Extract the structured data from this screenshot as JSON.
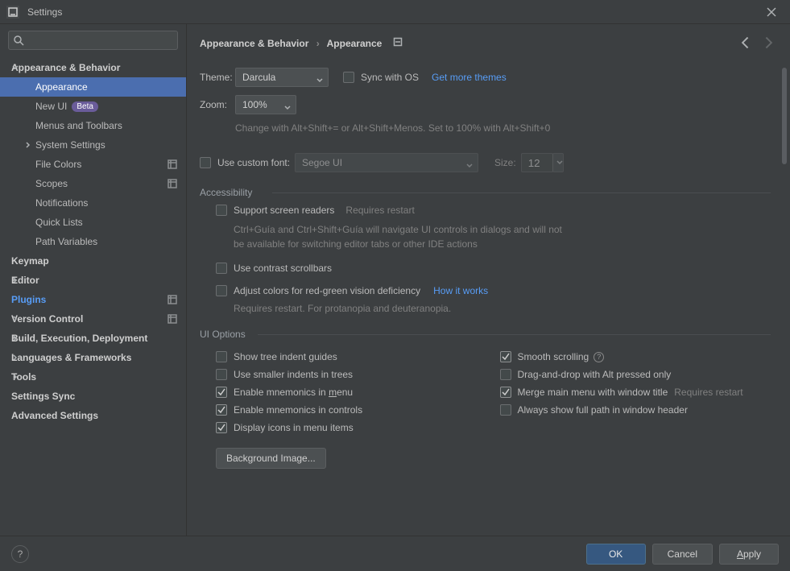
{
  "window": {
    "title": "Settings"
  },
  "search": {
    "placeholder": ""
  },
  "sidebar": [
    {
      "label": "Appearance & Behavior",
      "level": 0,
      "expandable": true,
      "expanded": true
    },
    {
      "label": "Appearance",
      "level": 1,
      "selected": true
    },
    {
      "label": "New UI",
      "level": 1,
      "badge": "Beta"
    },
    {
      "label": "Menus and Toolbars",
      "level": 1
    },
    {
      "label": "System Settings",
      "level": 1,
      "expandable": true,
      "expanded": false
    },
    {
      "label": "File Colors",
      "level": 1,
      "gear": true
    },
    {
      "label": "Scopes",
      "level": 1,
      "gear": true
    },
    {
      "label": "Notifications",
      "level": 1
    },
    {
      "label": "Quick Lists",
      "level": 1
    },
    {
      "label": "Path Variables",
      "level": 1
    },
    {
      "label": "Keymap",
      "level": 0
    },
    {
      "label": "Editor",
      "level": 0,
      "expandable": true,
      "expanded": false
    },
    {
      "label": "Plugins",
      "level": 0,
      "blue": true,
      "gear": true
    },
    {
      "label": "Version Control",
      "level": 0,
      "expandable": true,
      "expanded": false,
      "gear": true
    },
    {
      "label": "Build, Execution, Deployment",
      "level": 0,
      "expandable": true,
      "expanded": false
    },
    {
      "label": "Languages & Frameworks",
      "level": 0,
      "expandable": true,
      "expanded": false
    },
    {
      "label": "Tools",
      "level": 0,
      "expandable": true,
      "expanded": false
    },
    {
      "label": "Settings Sync",
      "level": 0
    },
    {
      "label": "Advanced Settings",
      "level": 0
    }
  ],
  "breadcrumb": {
    "root": "Appearance & Behavior",
    "leaf": "Appearance"
  },
  "theme": {
    "label": "Theme:",
    "value": "Darcula",
    "sync_label": "Sync with OS",
    "sync_checked": false,
    "more_link": "Get more themes"
  },
  "zoom": {
    "label": "Zoom:",
    "value": "100%",
    "hint": "Change with Alt+Shift+= or Alt+Shift+Menos. Set to 100% with Alt+Shift+0"
  },
  "custom_font": {
    "checked": false,
    "label": "Use custom font:",
    "font": "Segoe UI",
    "size_label": "Size:",
    "size": "12"
  },
  "accessibility": {
    "title": "Accessibility",
    "screen_readers": {
      "checked": false,
      "label": "Support screen readers",
      "suffix": "Requires restart",
      "hint": "Ctrl+Guía and Ctrl+Shift+Guía will navigate UI controls in dialogs and will not be available for switching editor tabs or other IDE actions"
    },
    "contrast": {
      "checked": false,
      "label": "Use contrast scrollbars"
    },
    "colorblind": {
      "checked": false,
      "label": "Adjust colors for red-green vision deficiency",
      "link": "How it works",
      "hint": "Requires restart. For protanopia and deuteranopia."
    }
  },
  "ui_options": {
    "title": "UI Options",
    "left": [
      {
        "key": "tree_indent",
        "checked": false,
        "label": "Show tree indent guides"
      },
      {
        "key": "smaller_indents",
        "checked": false,
        "label": "Use smaller indents in trees"
      },
      {
        "key": "mnemonics_menu",
        "checked": true,
        "label_pre": "Enable mnemonics in ",
        "label_u": "m",
        "label_post": "enu"
      },
      {
        "key": "mnemonics_controls",
        "checked": true,
        "label": "Enable mnemonics in controls"
      },
      {
        "key": "icons_menu",
        "checked": true,
        "label": "Display icons in menu items"
      }
    ],
    "right": [
      {
        "key": "smooth_scroll",
        "checked": true,
        "label": "Smooth scrolling",
        "info": true
      },
      {
        "key": "dnd_alt",
        "checked": false,
        "label": "Drag-and-drop with Alt pressed only"
      },
      {
        "key": "merge_menu",
        "checked": true,
        "label": "Merge main menu with window title",
        "suffix": "Requires restart"
      },
      {
        "key": "full_path",
        "checked": false,
        "label": "Always show full path in window header"
      }
    ],
    "bg_button": "Background Image..."
  },
  "footer": {
    "ok": "OK",
    "cancel": "Cancel",
    "apply": "Apply"
  }
}
